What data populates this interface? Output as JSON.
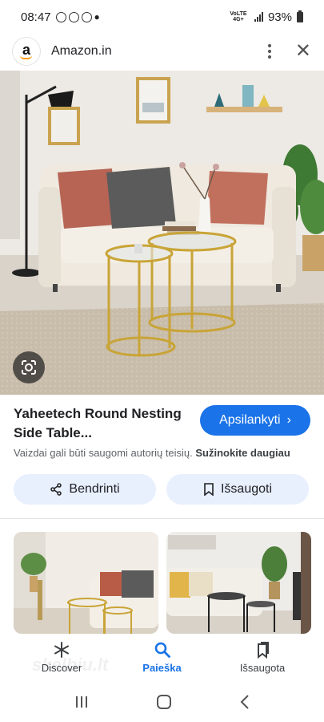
{
  "status": {
    "time": "08:47",
    "network_label": "VoLTE 4G+",
    "battery": "93%"
  },
  "header": {
    "logo_letter": "a",
    "site_name": "Amazon.in"
  },
  "result": {
    "title": "Yaheetech Round Nesting Side Table...",
    "visit_label": "Apsilankyti",
    "disclaimer_text": "Vaizdai gali būti saugomi autorių teisių. ",
    "learn_more": "Sužinokite daugiau"
  },
  "actions": {
    "share_label": "Bendrinti",
    "save_label": "Išsaugoti"
  },
  "bottom_nav": {
    "items": [
      {
        "label": "Discover",
        "icon": "asterisk-icon"
      },
      {
        "label": "Paieška",
        "icon": "search-icon"
      },
      {
        "label": "Išsaugota",
        "icon": "bookmarks-icon"
      }
    ],
    "active": "Paieška"
  },
  "watermark": "skelbiu.lt",
  "colors": {
    "accent": "#1a73e8",
    "pill_bg": "#e8f0fe",
    "sofa": "#efe9df",
    "gold": "#c9a437",
    "pillow_red": "#b76454",
    "pillow_grey": "#5b5b5b"
  }
}
